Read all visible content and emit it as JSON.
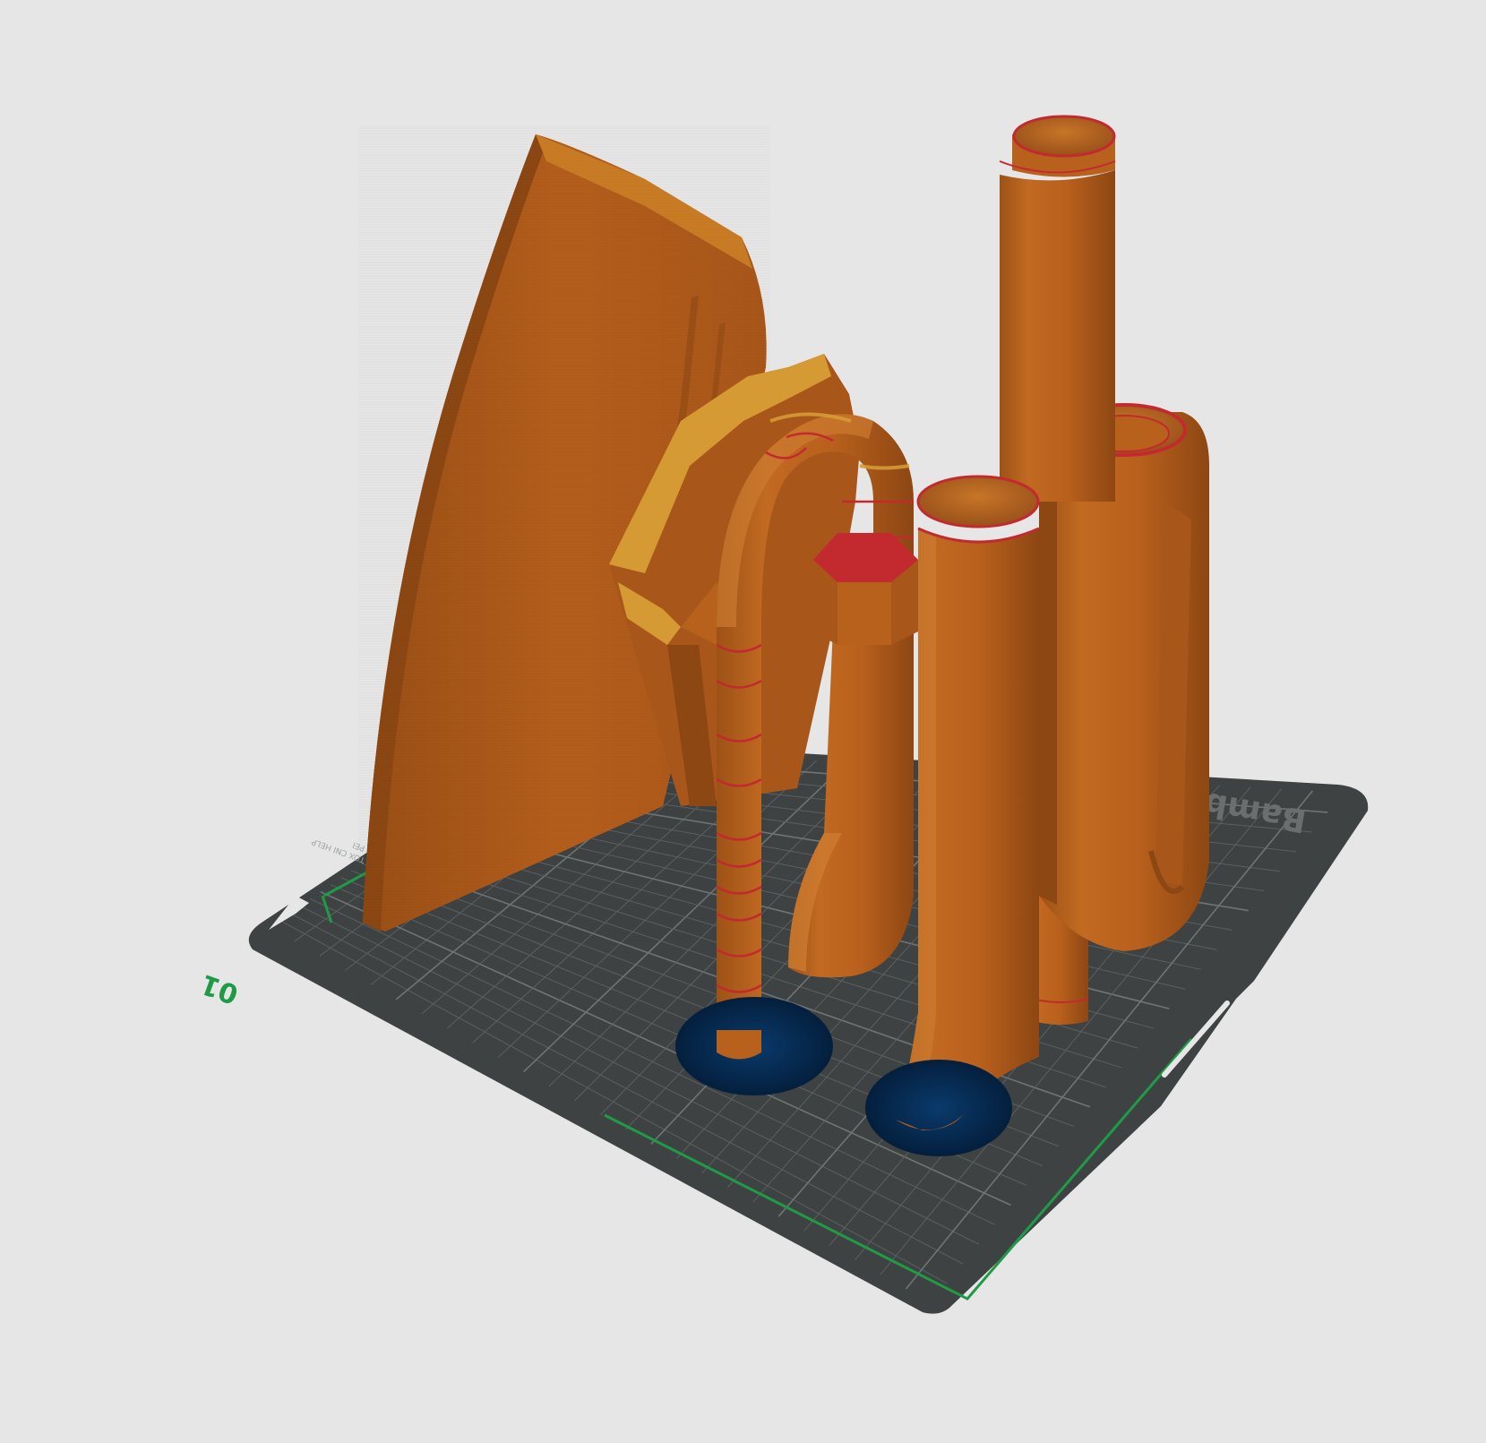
{
  "plate": {
    "number": "01",
    "brand": "Bambu",
    "print_line_1": "PEI",
    "print_line_2": "TOX CNI HELP",
    "bed_color": "#3f4242",
    "grid_color": "#5c6060",
    "grid_major_color": "#6f7474",
    "origin_marker_color": "#1f9b46"
  },
  "colors": {
    "background": "#e6e6e6",
    "filament_primary": "#b8611c",
    "filament_shadow": "#8d4713",
    "filament_highlight": "#cd7a31",
    "filament_light": "#c97c25",
    "overhang_red": "#c22a2f",
    "support_yellow": "#d69a34",
    "brim_blue": "#062b52"
  },
  "objects": [
    {
      "name": "curved-panel",
      "kind": "fin"
    },
    {
      "name": "bracket-part",
      "kind": "bracket"
    },
    {
      "name": "segmented-hose",
      "kind": "bent-tube"
    },
    {
      "name": "nut-fitting-tube",
      "kind": "tube"
    },
    {
      "name": "front-tall-tube",
      "kind": "tube"
    },
    {
      "name": "rear-tallest-tube",
      "kind": "tube"
    },
    {
      "name": "wide-round-housing",
      "kind": "tube"
    },
    {
      "name": "small-cylinder",
      "kind": "cylinder"
    }
  ]
}
